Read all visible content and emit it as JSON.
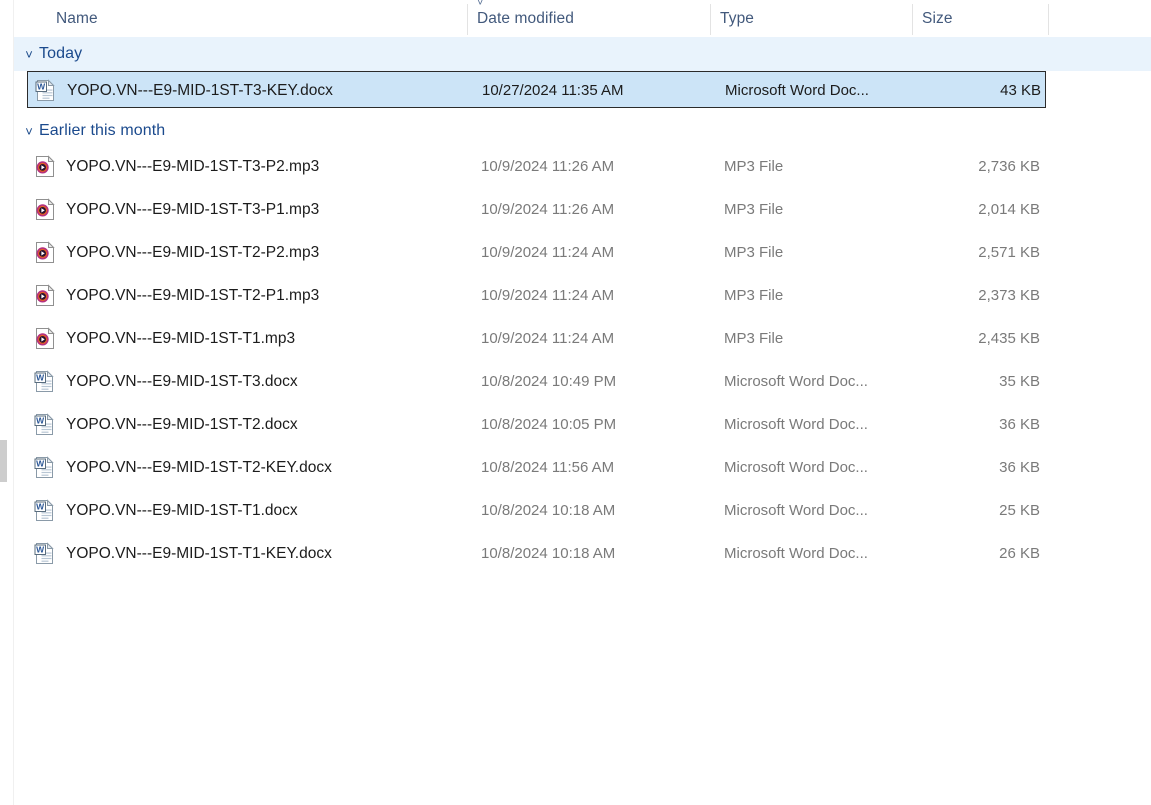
{
  "window": {
    "app": "File Explorer",
    "view": "details-list"
  },
  "columns": {
    "sort_indicator_icon": "chevron-down-icon",
    "sorted_by": "Date modified",
    "headers": [
      {
        "label": "Name",
        "key": "name"
      },
      {
        "label": "Date modified",
        "key": "date"
      },
      {
        "label": "Type",
        "key": "type"
      },
      {
        "label": "Size",
        "key": "size"
      }
    ]
  },
  "groups": [
    {
      "label": "Today",
      "chevron_icon": "chevron-down-icon",
      "expanded": true,
      "banded": true,
      "items": [
        {
          "name": "YOPO.VN---E9-MID-1ST-T3-KEY.docx",
          "date": "10/27/2024 11:35 AM",
          "type": "Microsoft Word Doc...",
          "size": "43 KB",
          "icon": "word-document-icon",
          "selected": true
        }
      ]
    },
    {
      "label": "Earlier this month",
      "chevron_icon": "chevron-down-icon",
      "expanded": true,
      "banded": false,
      "items": [
        {
          "name": "YOPO.VN---E9-MID-1ST-T3-P2.mp3",
          "date": "10/9/2024 11:26 AM",
          "type": "MP3 File",
          "size": "2,736 KB",
          "icon": "mp3-audio-icon",
          "selected": false
        },
        {
          "name": "YOPO.VN---E9-MID-1ST-T3-P1.mp3",
          "date": "10/9/2024 11:26 AM",
          "type": "MP3 File",
          "size": "2,014 KB",
          "icon": "mp3-audio-icon",
          "selected": false
        },
        {
          "name": "YOPO.VN---E9-MID-1ST-T2-P2.mp3",
          "date": "10/9/2024 11:24 AM",
          "type": "MP3 File",
          "size": "2,571 KB",
          "icon": "mp3-audio-icon",
          "selected": false
        },
        {
          "name": "YOPO.VN---E9-MID-1ST-T2-P1.mp3",
          "date": "10/9/2024 11:24 AM",
          "type": "MP3 File",
          "size": "2,373 KB",
          "icon": "mp3-audio-icon",
          "selected": false
        },
        {
          "name": "YOPO.VN---E9-MID-1ST-T1.mp3",
          "date": "10/9/2024 11:24 AM",
          "type": "MP3 File",
          "size": "2,435 KB",
          "icon": "mp3-audio-icon",
          "selected": false
        },
        {
          "name": "YOPO.VN---E9-MID-1ST-T3.docx",
          "date": "10/8/2024 10:49 PM",
          "type": "Microsoft Word Doc...",
          "size": "35 KB",
          "icon": "word-document-icon",
          "selected": false
        },
        {
          "name": "YOPO.VN---E9-MID-1ST-T2.docx",
          "date": "10/8/2024 10:05 PM",
          "type": "Microsoft Word Doc...",
          "size": "36 KB",
          "icon": "word-document-icon",
          "selected": false
        },
        {
          "name": "YOPO.VN---E9-MID-1ST-T2-KEY.docx",
          "date": "10/8/2024 11:56 AM",
          "type": "Microsoft Word Doc...",
          "size": "36 KB",
          "icon": "word-document-icon",
          "selected": false
        },
        {
          "name": "YOPO.VN---E9-MID-1ST-T1.docx",
          "date": "10/8/2024 10:18 AM",
          "type": "Microsoft Word Doc...",
          "size": "25 KB",
          "icon": "word-document-icon",
          "selected": false
        },
        {
          "name": "YOPO.VN---E9-MID-1ST-T1-KEY.docx",
          "date": "10/8/2024 10:18 AM",
          "type": "Microsoft Word Doc...",
          "size": "26 KB",
          "icon": "word-document-icon",
          "selected": false
        }
      ]
    }
  ],
  "scrollbar": {
    "name": "left-pane-scrollbar",
    "visible": true
  },
  "colors": {
    "group_band": "#e9f3fc",
    "selection_fill": "#cce4f7",
    "selection_border": "#2b2b2b",
    "group_label": "#1b4a8d",
    "header_text": "#42597c",
    "secondary_text": "#7a7a7a",
    "primary_text": "#1c1c1c"
  }
}
